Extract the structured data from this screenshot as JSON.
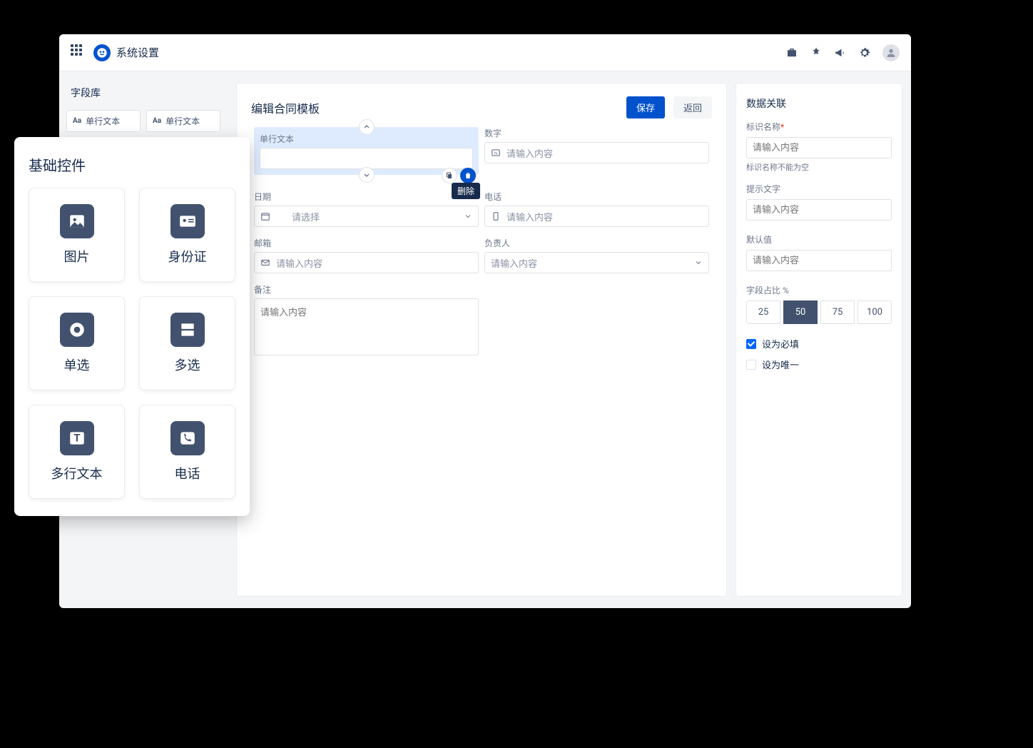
{
  "header": {
    "app_title": "系统设置"
  },
  "left_panel": {
    "title": "字段库",
    "chips": [
      {
        "label": "单行文本"
      },
      {
        "label": "单行文本"
      }
    ]
  },
  "center": {
    "title": "编辑合同模板",
    "save_label": "保存",
    "back_label": "返回",
    "tooltip_delete": "删除",
    "fields": {
      "single_text": {
        "label": "单行文本"
      },
      "number": {
        "label": "数字",
        "placeholder": "请输入内容"
      },
      "date": {
        "label": "日期",
        "placeholder": "请选择"
      },
      "phone": {
        "label": "电话",
        "placeholder": "请输入内容"
      },
      "email": {
        "label": "邮箱",
        "placeholder": "请输入内容"
      },
      "owner": {
        "label": "负责人",
        "placeholder": "请输入内容"
      },
      "remark": {
        "label": "备注",
        "placeholder": "请输入内容"
      }
    }
  },
  "right_panel": {
    "title": "数据关联",
    "ident_label": "标识名称",
    "ident_placeholder": "请输入内容",
    "ident_error": "标识名称不能为空",
    "hint_label": "提示文字",
    "hint_placeholder": "请输入内容",
    "default_label": "默认值",
    "default_placeholder": "请输入内容",
    "ratio_label": "字段占比 %",
    "ratio_options": [
      "25",
      "50",
      "75",
      "100"
    ],
    "ratio_active": "50",
    "required_label": "设为必填",
    "unique_label": "设为唯一"
  },
  "palette": {
    "title": "基础控件",
    "items": [
      {
        "label": "图片"
      },
      {
        "label": "身份证"
      },
      {
        "label": "单选"
      },
      {
        "label": "多选"
      },
      {
        "label": "多行文本"
      },
      {
        "label": "电话"
      }
    ]
  }
}
